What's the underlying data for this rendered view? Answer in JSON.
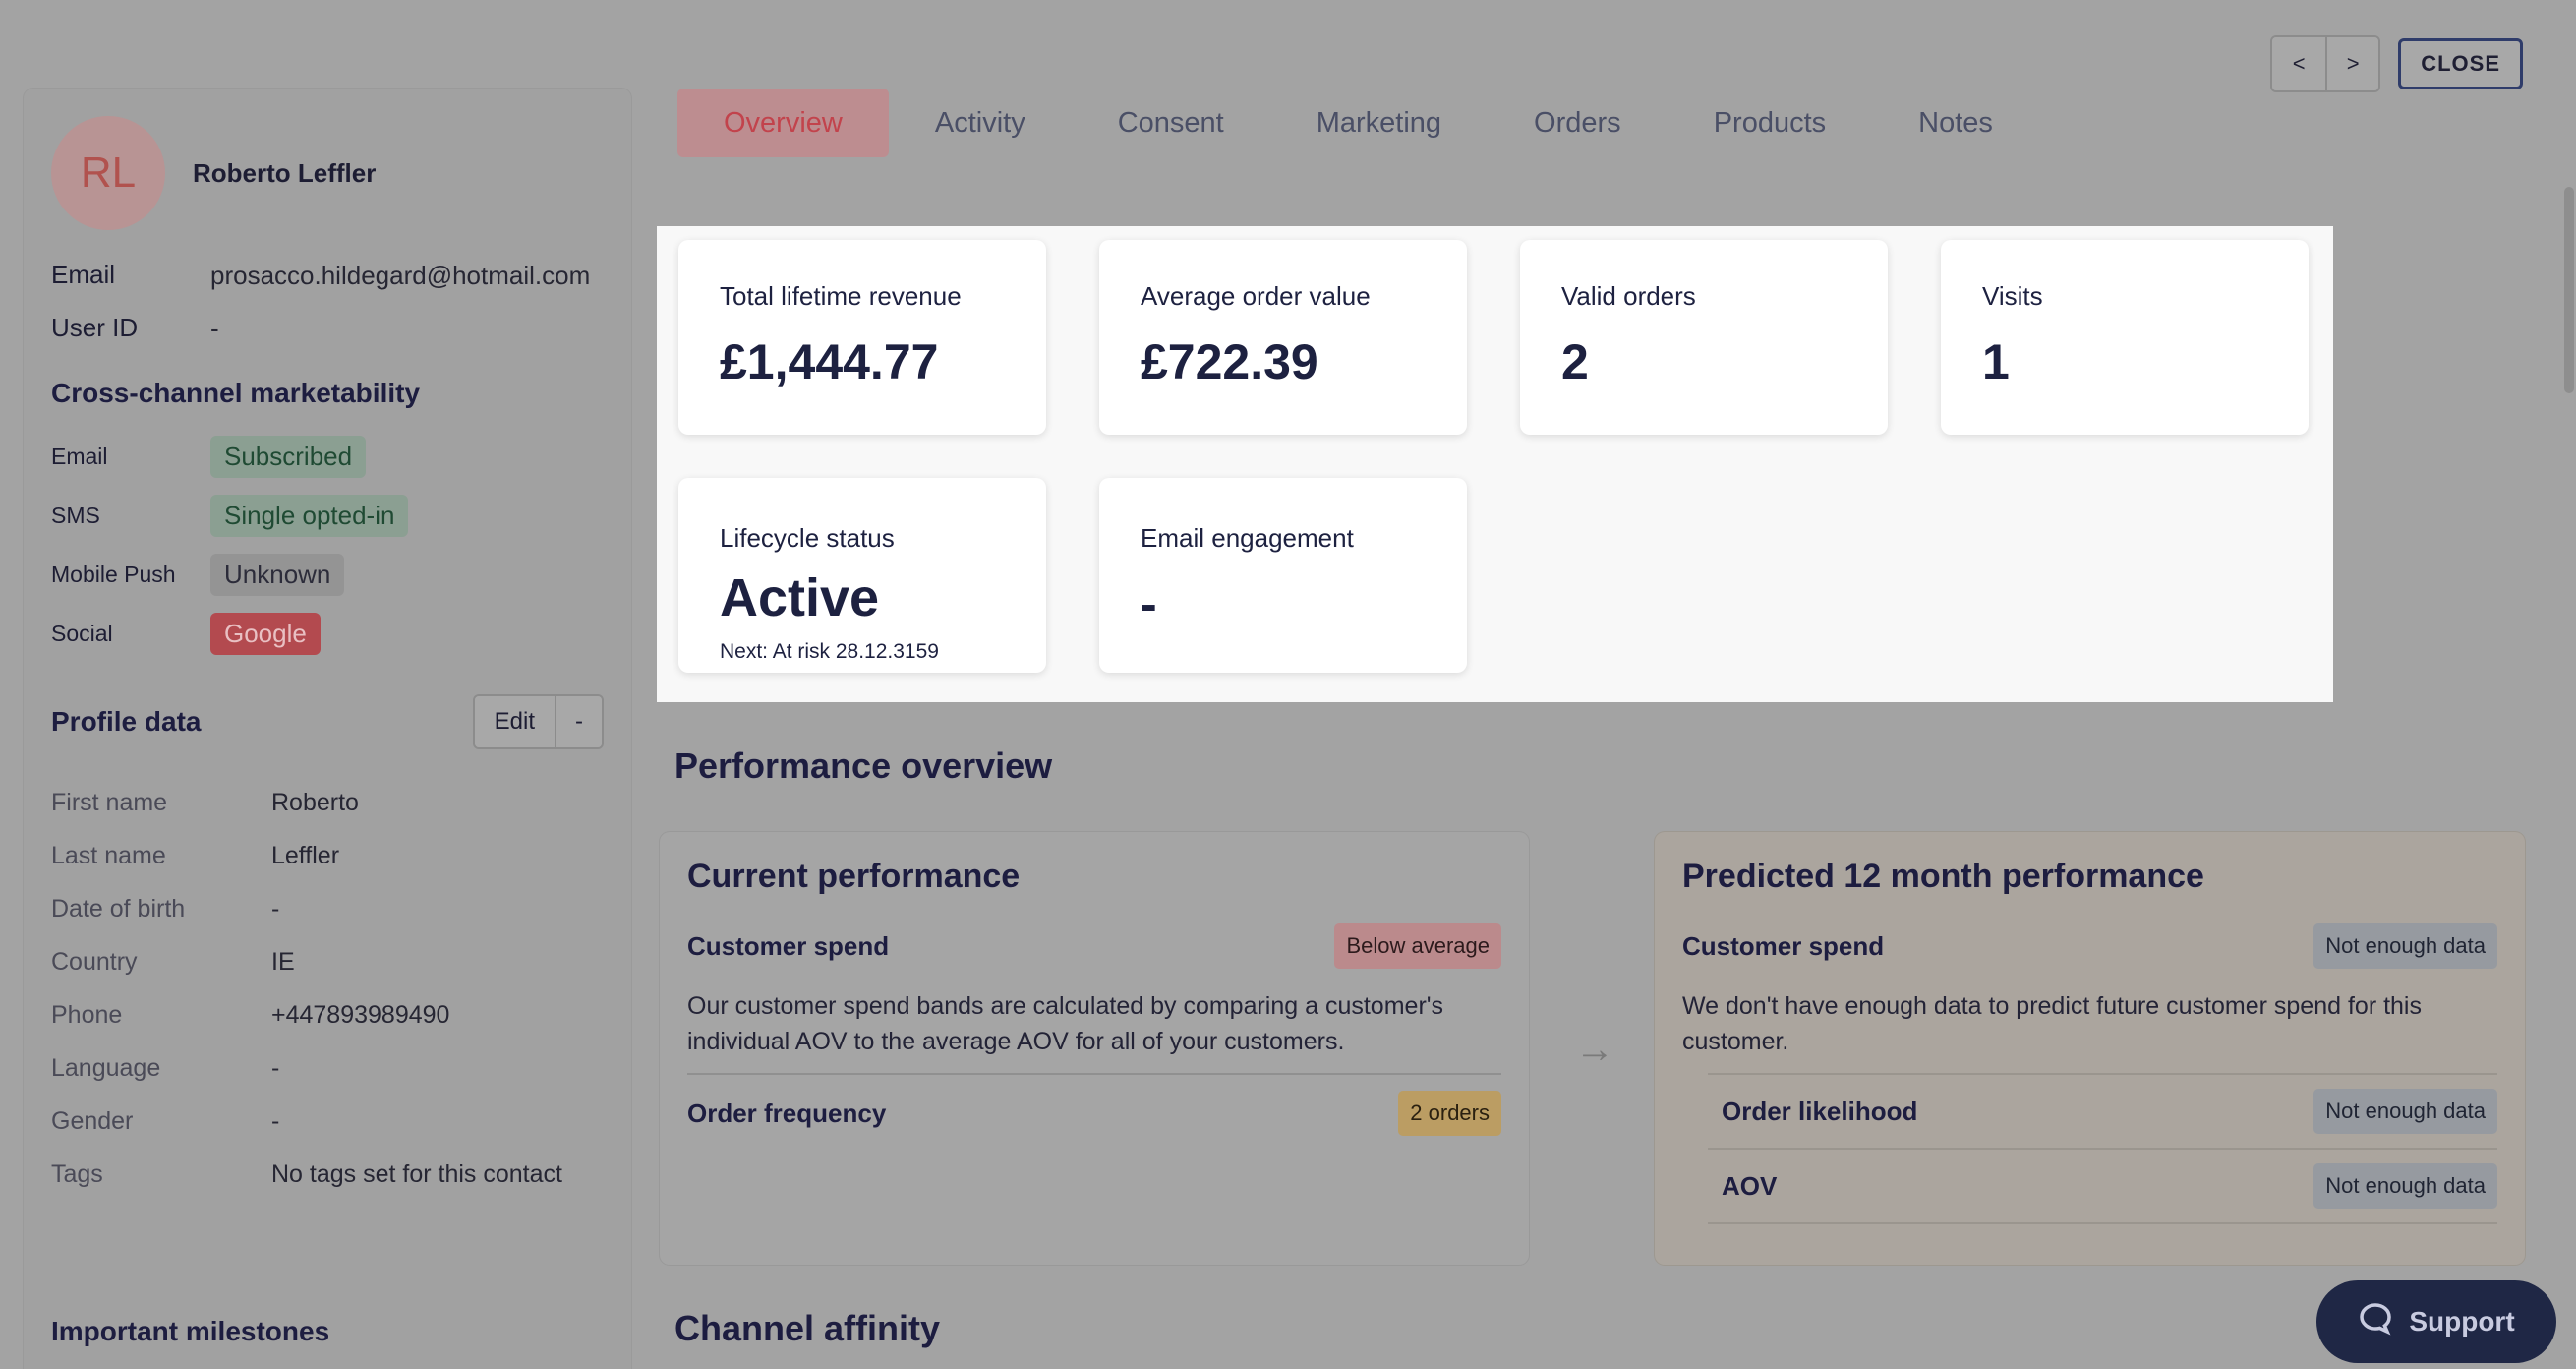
{
  "nav": {
    "prev": "<",
    "next": ">",
    "close": "CLOSE"
  },
  "profile": {
    "initials": "RL",
    "name": "Roberto Leffler",
    "email_label": "Email",
    "email": "prosacco.hildegard@hotmail.com",
    "userid_label": "User ID",
    "userid": "-"
  },
  "marketability": {
    "title": "Cross-channel marketability",
    "rows": [
      {
        "label": "Email",
        "value": "Subscribed"
      },
      {
        "label": "SMS",
        "value": "Single opted-in"
      },
      {
        "label": "Mobile Push",
        "value": "Unknown"
      },
      {
        "label": "Social",
        "value": "Google"
      }
    ]
  },
  "profile_data": {
    "title": "Profile data",
    "edit": "Edit",
    "dropdown": "-",
    "rows": [
      {
        "label": "First name",
        "value": "Roberto"
      },
      {
        "label": "Last name",
        "value": "Leffler"
      },
      {
        "label": "Date of birth",
        "value": "-"
      },
      {
        "label": "Country",
        "value": "IE"
      },
      {
        "label": "Phone",
        "value": "+447893989490"
      },
      {
        "label": "Language",
        "value": "-"
      },
      {
        "label": "Gender",
        "value": "-"
      },
      {
        "label": "Tags",
        "value": "No tags set for this contact"
      }
    ]
  },
  "milestones_title": "Important milestones",
  "tabs": [
    "Overview",
    "Activity",
    "Consent",
    "Marketing",
    "Orders",
    "Products",
    "Notes"
  ],
  "stats": [
    {
      "label": "Total lifetime revenue",
      "value": "£1,444.77"
    },
    {
      "label": "Average order value",
      "value": "£722.39"
    },
    {
      "label": "Valid orders",
      "value": "2"
    },
    {
      "label": "Visits",
      "value": "1"
    },
    {
      "label": "Lifecycle status",
      "value": "Active",
      "sub": "Next: At risk 28.12.3159"
    },
    {
      "label": "Email engagement",
      "value": "-"
    }
  ],
  "performance": {
    "title": "Performance overview",
    "current": {
      "title": "Current performance",
      "spend_label": "Customer spend",
      "spend_tag": "Below average",
      "spend_desc": "Our customer spend bands are calculated by comparing a customer's individual AOV to the average AOV for all of your customers.",
      "freq_label": "Order frequency",
      "freq_tag": "2 orders"
    },
    "predicted": {
      "title": "Predicted 12 month performance",
      "spend_label": "Customer spend",
      "spend_tag": "Not enough data",
      "spend_desc": "We don't have enough data to predict future customer spend for this customer.",
      "likelihood_label": "Order likelihood",
      "likelihood_tag": "Not enough data",
      "aov_label": "AOV",
      "aov_tag": "Not enough data"
    }
  },
  "channel_title": "Channel affinity",
  "support": "Support"
}
